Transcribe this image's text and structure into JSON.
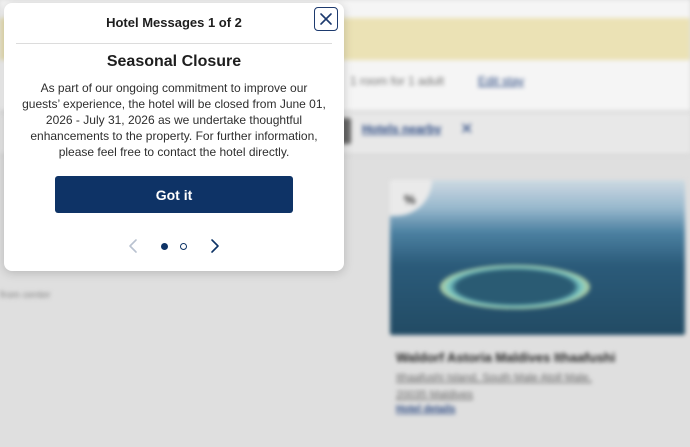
{
  "modal": {
    "title": "Hotel Messages 1 of 2",
    "heading": "Seasonal Closure",
    "body": "As part of our ongoing commitment to improve our guests’ experience, the hotel will be closed from June 01, 2026 - July 31, 2026 as we undertake thoughtful enhancements to the property. For further information, please feel free to contact the hotel directly.",
    "button_label": "Got it",
    "page_count": 2,
    "current_page": 1,
    "accent_color": "#0e3366"
  },
  "background": {
    "search_summary": "1 room for 1 adult",
    "edit_link": "Edit stay",
    "filter_label": "Hotels nearby",
    "side_text": "from center",
    "hotel_card": {
      "badge": "%",
      "name": "Waldorf Astoria Maldives Ithaafushi",
      "address": "Ithaafushi Island, South Male Atoll Male, 20035 Maldives",
      "details_link": "Hotel details"
    }
  }
}
